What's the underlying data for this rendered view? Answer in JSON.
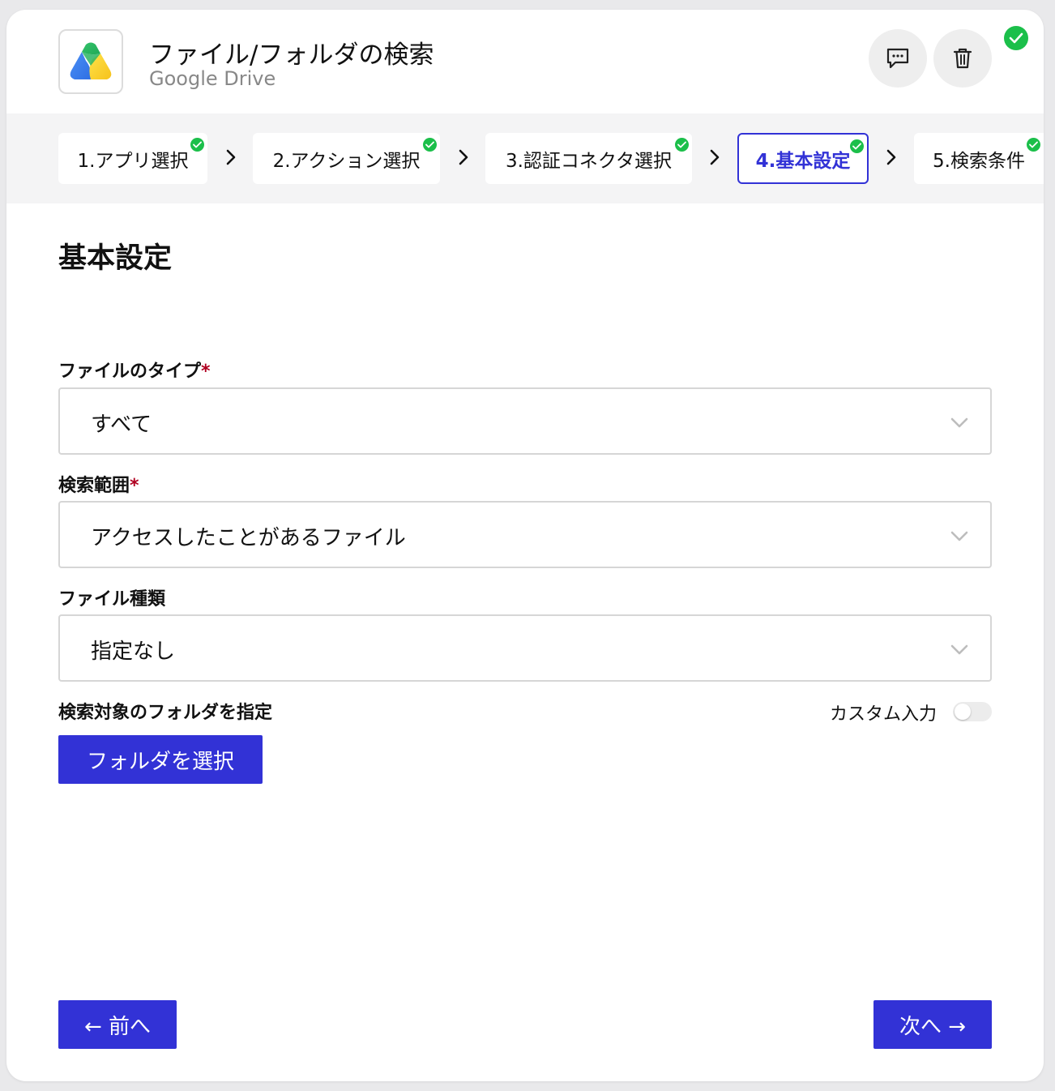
{
  "header": {
    "title": "ファイル/フォルダの検索",
    "subtitle": "Google Drive",
    "app_icon": "google-drive-icon",
    "comment_icon": "comment-icon",
    "delete_icon": "trash-icon",
    "status": "complete"
  },
  "stepper": {
    "steps": [
      {
        "label": "1.アプリ選択",
        "completed": true,
        "active": false
      },
      {
        "label": "2.アクション選択",
        "completed": true,
        "active": false
      },
      {
        "label": "3.認証コネクタ選択",
        "completed": true,
        "active": false
      },
      {
        "label": "4.基本設定",
        "completed": true,
        "active": true
      },
      {
        "label": "5.検索条件",
        "completed": true,
        "active": false
      }
    ]
  },
  "form": {
    "section_title": "基本設定",
    "file_type": {
      "label": "ファイルのタイプ",
      "required_mark": "*",
      "value": "すべて"
    },
    "search_scope": {
      "label": "検索範囲",
      "required_mark": "*",
      "value": "アクセスしたことがあるファイル"
    },
    "file_kind": {
      "label": "ファイル種類",
      "value": "指定なし"
    },
    "target_folder": {
      "label": "検索対象のフォルダを指定",
      "custom_input_label": "カスタム入力",
      "custom_input_on": false,
      "select_button": "フォルダを選択"
    }
  },
  "footer": {
    "prev_button": "← 前へ",
    "next_button": "次へ →"
  },
  "colors": {
    "primary": "#3232d6",
    "success": "#1bbf4a",
    "required": "#b00020",
    "stepper_bg": "#f4f4f5"
  }
}
